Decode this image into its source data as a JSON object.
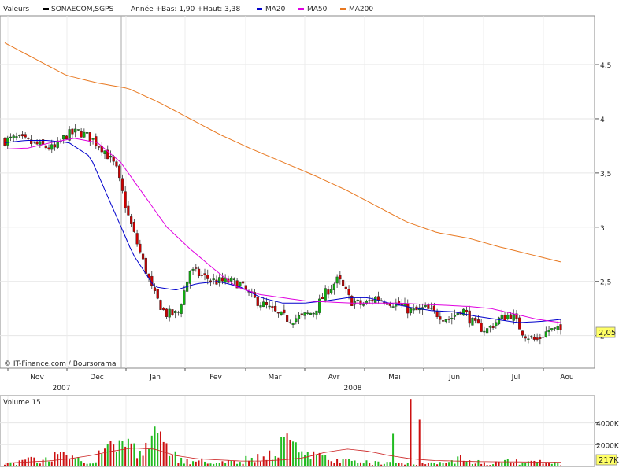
{
  "header": {
    "prefix": "Valeurs",
    "ticker": "SONAECOM,SGPS",
    "range_text": "Année +Bas: 1,90 +Haut: 3,38",
    "legend": [
      {
        "name": "MA20",
        "color": "#0000cc"
      },
      {
        "name": "MA50",
        "color": "#e000e0"
      },
      {
        "name": "MA200",
        "color": "#e87820"
      }
    ]
  },
  "copyright": "© IT-Finance.com / Boursorama",
  "last_price_badge": "2,05",
  "volume_title": "Volume 15",
  "volume_badge": "217K",
  "chart_data": [
    {
      "type": "candlestick",
      "title": "SONAECOM,SGPS",
      "ylim": [
        1.7,
        4.95
      ],
      "y_ticks": [
        {
          "value": 2,
          "label": "2"
        },
        {
          "value": 2.5,
          "label": "2,5"
        },
        {
          "value": 3,
          "label": "3"
        },
        {
          "value": 3.5,
          "label": "3,5"
        },
        {
          "value": 4,
          "label": "4"
        },
        {
          "value": 4.5,
          "label": "4,5"
        }
      ],
      "x_months": [
        "Nov",
        "Dec",
        "Jan",
        "Fev",
        "Mar",
        "Avr",
        "Mai",
        "Jun",
        "Jul",
        "Aou"
      ],
      "x_years": [
        "2007",
        "2008"
      ],
      "grid": true,
      "close_anchors": [
        3.8,
        3.82,
        3.78,
        3.75,
        3.72,
        3.85,
        3.88,
        3.82,
        3.72,
        3.55,
        3.1,
        2.75,
        2.4,
        2.2,
        2.2,
        2.6,
        2.55,
        2.5,
        2.5,
        2.48,
        2.35,
        2.28,
        2.2,
        2.15,
        2.17,
        2.22,
        2.4,
        2.52,
        2.32,
        2.28,
        2.35,
        2.32,
        2.28,
        2.22,
        2.25,
        2.2,
        2.15,
        2.25,
        2.1,
        2.05,
        2.15,
        2.2,
        2.02,
        1.95,
        2.05,
        2.05
      ],
      "series": [
        {
          "name": "MA20",
          "color": "#0000cc",
          "values": [
            3.78,
            3.8,
            3.8,
            3.78,
            3.65,
            3.2,
            2.75,
            2.45,
            2.42,
            2.48,
            2.5,
            2.45,
            2.35,
            2.3,
            2.3,
            2.32,
            2.35,
            2.35,
            2.3,
            2.26,
            2.23,
            2.22,
            2.18,
            2.15,
            2.12,
            2.13,
            2.15
          ]
        },
        {
          "name": "MA50",
          "color": "#e000e0",
          "values": [
            3.72,
            3.73,
            3.78,
            3.82,
            3.78,
            3.6,
            3.3,
            3.0,
            2.8,
            2.62,
            2.45,
            2.38,
            2.35,
            2.32,
            2.31,
            2.3,
            2.3,
            2.3,
            2.29,
            2.28,
            2.27,
            2.25,
            2.2,
            2.15,
            2.12
          ]
        },
        {
          "name": "MA200",
          "color": "#e87820",
          "values": [
            4.7,
            4.55,
            4.4,
            4.33,
            4.28,
            4.15,
            4.0,
            3.85,
            3.72,
            3.6,
            3.48,
            3.35,
            3.2,
            3.05,
            2.95,
            2.9,
            2.82,
            2.75,
            2.68
          ]
        }
      ]
    },
    {
      "type": "bar",
      "title": "Volume 15",
      "ylim": [
        0,
        6500
      ],
      "y_ticks": [
        {
          "value": 2000,
          "label": "2000K"
        },
        {
          "value": 4000,
          "label": "4000K"
        }
      ],
      "last_value_label": "217K",
      "volume_anchors": [
        400,
        300,
        600,
        350,
        900,
        1100,
        600,
        400,
        1800,
        2200,
        1600,
        900,
        2400,
        1900,
        600,
        400,
        450,
        300,
        350,
        300,
        900,
        600,
        1500,
        2700,
        1200,
        900,
        600,
        500,
        400,
        350,
        300,
        250,
        300,
        350,
        300,
        280,
        300,
        900,
        400,
        300,
        350,
        450,
        300,
        400,
        300,
        217
      ],
      "spikes": [
        {
          "i": 0.73,
          "v": 6200
        },
        {
          "i": 0.745,
          "v": 4300
        },
        {
          "i": 0.7,
          "v": 3000
        }
      ],
      "volume_ma": [
        300,
        400,
        500,
        700,
        1000,
        1400,
        1700,
        1600,
        1000,
        700,
        600,
        500,
        500,
        600,
        800,
        1300,
        1600,
        1400,
        1000,
        700,
        550,
        500,
        450,
        430,
        420,
        400,
        380
      ]
    }
  ]
}
